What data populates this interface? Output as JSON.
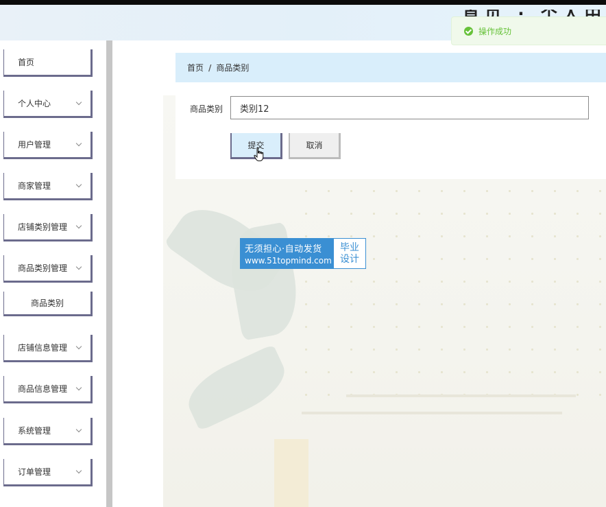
{
  "header": {
    "title_peek": "首页 · 个人中心"
  },
  "toast": {
    "message": "操作成功"
  },
  "sidebar": {
    "items": [
      {
        "label": "首页",
        "has_arrow": false
      },
      {
        "label": "个人中心",
        "has_arrow": true
      },
      {
        "label": "用户管理",
        "has_arrow": true
      },
      {
        "label": "商家管理",
        "has_arrow": true
      },
      {
        "label": "店铺类别管理",
        "has_arrow": true
      },
      {
        "label": "商品类别管理",
        "has_arrow": true
      },
      {
        "label": "商品类别",
        "has_arrow": false
      },
      {
        "label": "店铺信息管理",
        "has_arrow": true
      },
      {
        "label": "商品信息管理",
        "has_arrow": true
      },
      {
        "label": "系统管理",
        "has_arrow": true
      },
      {
        "label": "订单管理",
        "has_arrow": true
      }
    ]
  },
  "breadcrumb": {
    "home": "首页",
    "separator": "/",
    "current": "商品类别"
  },
  "form": {
    "label": "商品类别",
    "value": "类别12",
    "submit_label": "提交",
    "cancel_label": "取消"
  },
  "watermark": {
    "line1": "无须担心·自动发货",
    "line2": "www.51topmind.com",
    "right_line1": "毕业",
    "right_line2": "设计"
  },
  "colors": {
    "accent": "#d9eefb",
    "menu_border": "#6b6b8c",
    "success": "#67c23a",
    "watermark_blue": "#3a8fd3"
  }
}
